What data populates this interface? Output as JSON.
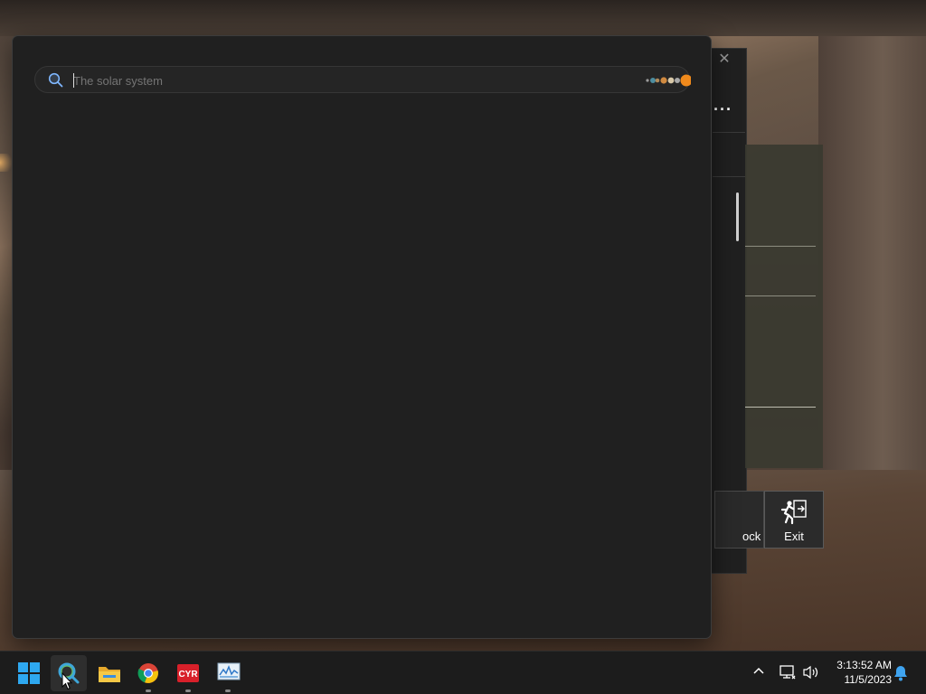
{
  "search": {
    "placeholder": "The solar system"
  },
  "background_window": {
    "close_icon": "close-icon",
    "more_icon": "more-options-icon",
    "lock_label": "ock",
    "exit_label": "Exit"
  },
  "taskbar": {
    "apps": [
      {
        "name": "start",
        "icon": "windows-logo-icon"
      },
      {
        "name": "search",
        "icon": "search-icon"
      },
      {
        "name": "file-explorer",
        "icon": "folder-icon"
      },
      {
        "name": "chrome",
        "icon": "chrome-icon"
      },
      {
        "name": "cyberlink",
        "icon": "cyr-app-icon"
      },
      {
        "name": "monitor",
        "icon": "resource-monitor-icon"
      }
    ],
    "clock": {
      "time": "3:13:52 AM",
      "date": "11/5/2023"
    }
  }
}
